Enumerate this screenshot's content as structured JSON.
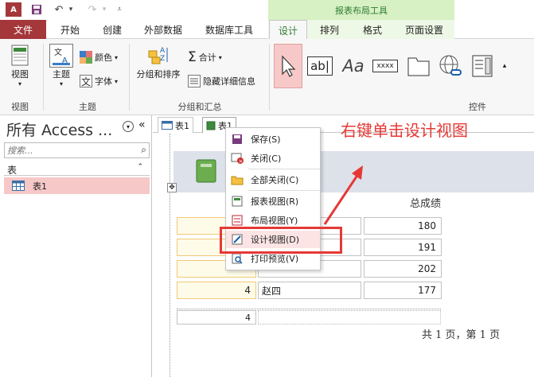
{
  "titlebar": {
    "app_logo": "A",
    "context_group": "报表布局工具",
    "quick_access": [
      "save-icon",
      "undo-icon",
      "redo-icon",
      "customize-icon"
    ]
  },
  "tabs": {
    "file": "文件",
    "home": "开始",
    "create": "创建",
    "external": "外部数据",
    "dbtools": "数据库工具",
    "design": "设计",
    "arrange": "排列",
    "format": "格式",
    "pagesetup": "页面设置"
  },
  "ribbon": {
    "views": {
      "label": "视图",
      "group": "视图"
    },
    "themes": {
      "themes_label": "主题",
      "colors_label": "颜色",
      "fonts_label": "字体",
      "group": "主题"
    },
    "grouping": {
      "group_sort": "分组和排序",
      "totals": "合计",
      "hide_details": "隐藏详细信息",
      "group": "分组和汇总"
    },
    "controls": {
      "group": "控件",
      "items": [
        "select-icon",
        "textbox-icon",
        "label-icon",
        "button-icon",
        "tab-control-icon",
        "hyperlink-icon",
        "nav-control-icon"
      ],
      "textbox_text": "ab|",
      "label_text": "Aa",
      "button_text": "xxxx"
    }
  },
  "nav": {
    "title": "所有 Access ...",
    "search_placeholder": "搜索...",
    "category": "表",
    "item": "表1"
  },
  "doc_tabs": {
    "tab1": "表1",
    "tab2": "表1"
  },
  "report": {
    "column_header": "总成绩",
    "rows": [
      {
        "id": "",
        "name": "",
        "score": "180"
      },
      {
        "id": "",
        "name": "",
        "score": "191"
      },
      {
        "id": "",
        "name": "",
        "score": "202"
      },
      {
        "id": "4",
        "name": "赵四",
        "score": "177"
      }
    ],
    "count": "4",
    "footer": "共 1 页，第 1 页"
  },
  "annotation": "右键单击设计视图",
  "context_menu": {
    "save": "保存(S)",
    "close": "关闭(C)",
    "close_all": "全部关闭(C)",
    "report_view": "报表视图(R)",
    "layout_view": "布局视图(Y)",
    "design_view": "设计视图(D)",
    "print_preview": "打印预览(V)"
  },
  "colors": {
    "file_tab": "#a4373a",
    "context_group_bg": "#d7f0c4",
    "highlight_red": "#e53935",
    "nav_item_selected": "#f7c8c8"
  }
}
